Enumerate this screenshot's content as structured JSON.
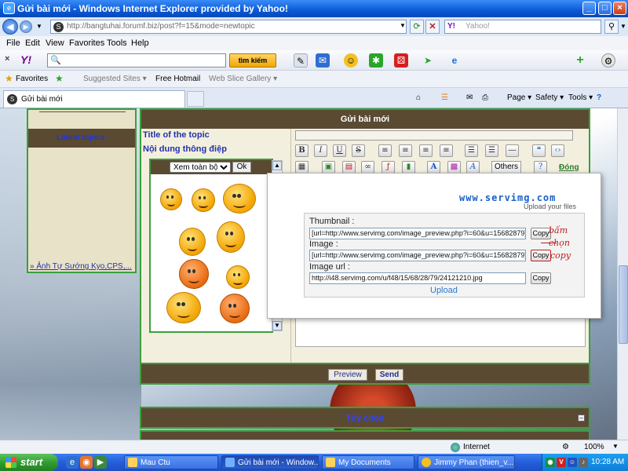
{
  "window": {
    "title": "Gửi bài mới - Windows Internet Explorer provided by Yahoo!",
    "controls": [
      "_",
      "□",
      "×"
    ]
  },
  "address": {
    "url": "http://bangtuhai.forumf.biz/post?f=15&mode=newtopic",
    "search_placeholder": "Yahoo!",
    "yahoo_mark": "Y!"
  },
  "menu": [
    "File",
    "Edit",
    "View",
    "Favorites",
    "Tools",
    "Help"
  ],
  "yahoo_toolbar": {
    "logo": "Y!",
    "search_button": "tìm kiếm"
  },
  "favorites_bar": {
    "favorites_label": "Favorites",
    "items": [
      "Suggested Sites ▾",
      "Free Hotmail",
      "Web Slice Gallery ▾"
    ]
  },
  "tabs": {
    "active_tab": "Gửi bài mới",
    "commands": [
      "Page ▾",
      "Safety ▾",
      "Tools ▾"
    ]
  },
  "sidebar": {
    "latest_topics_header": "Latest topics",
    "link": "» Ảnh Tự Sướng Kyo,CPS,..."
  },
  "form": {
    "header": "Gửi bài mới",
    "title_label": "Title of the topic",
    "content_label": "Nội dung thông điệp",
    "smiley_select": "Xem toàn bộ",
    "smiley_ok": "Ok",
    "editor_others": "Others",
    "editor_close": "Đóng",
    "preview_button": "Preview",
    "send_button": "Send",
    "options_header": "Tùy chọn"
  },
  "editor_icons": [
    "B",
    "I",
    "U",
    "S"
  ],
  "servimg": {
    "logo": "www.servimg.com",
    "tagline": "Upload your files",
    "thumbnail_label": "Thumbnail :",
    "thumbnail_value": "[url=http://www.servimg.com/image_preview.php?i=60&u=15682879][im",
    "image_label": "Image :",
    "image_value": "[url=http://www.servimg.com/image_preview.php?i=60&u=15682879][im",
    "image_url_label": "Image url :",
    "image_url_value": "http://i48.servimg.com/u/f48/15/68/28/79/24121210.jpg",
    "copy_label": "Copy",
    "upload_label": "Upload",
    "handwritten_note": [
      "bấm",
      "chọn",
      "copy"
    ]
  },
  "status_bar": {
    "zone": "Internet",
    "zoom": "100%"
  },
  "taskbar": {
    "start": "start",
    "tasks": [
      "Mau Ctu",
      "Gửi bài mới - Window...",
      "My Documents",
      "Jimmy Phan (thien_v..."
    ],
    "clock": "10:28 AM"
  }
}
